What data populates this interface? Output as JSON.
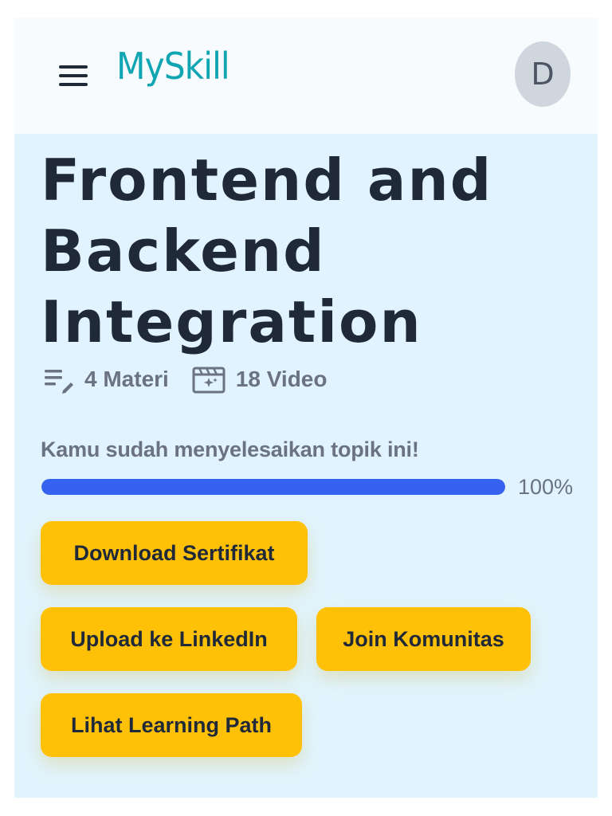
{
  "header": {
    "logo_text": "MySkill",
    "avatar_initial": "D",
    "brand_color": "#10a5b2"
  },
  "course": {
    "title_lines": [
      "Frontend and",
      "Backend",
      "Integration"
    ],
    "materials_label": "4 Materi",
    "videos_label": "18 Video"
  },
  "progress": {
    "status_text": "Kamu sudah menyelesaikan topik ini!",
    "value": 100,
    "value_label": "100%",
    "bar_color": "#3563f0"
  },
  "buttons": {
    "download_certificate": "Download Sertifikat",
    "upload_linkedin": "Upload ke LinkedIn",
    "join_community": "Join Komunitas",
    "view_learning_path": "Lihat Learning Path",
    "color": "#ffc107"
  },
  "icons": {
    "menu": "menu-icon",
    "materials": "list-edit-icon",
    "videos": "video-clapper-icon"
  }
}
